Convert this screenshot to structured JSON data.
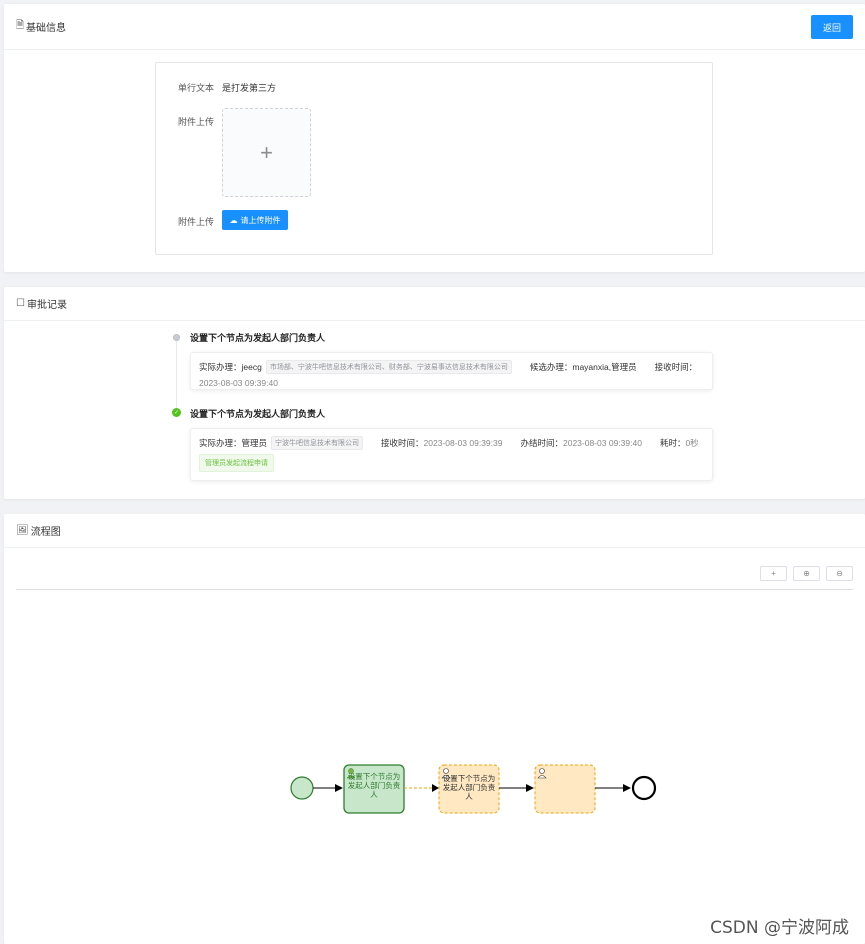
{
  "basic": {
    "title": "基础信息",
    "icon": "document-icon",
    "back_label": "返回",
    "fields": [
      {
        "label": "单行文本",
        "value": "是打发第三方"
      },
      {
        "label": "附件上传"
      },
      {
        "label": "附件上传"
      }
    ],
    "upload_plus": "+",
    "upload_button": "请上传附件"
  },
  "approval": {
    "title": "审批记录",
    "icon": "square-icon",
    "items": [
      {
        "title": "设置下个节点为发起人部门负责人",
        "actual_label": "实际办理：",
        "actual_value": "jeecg",
        "actual_tag": "市场部、宁波牛吧信息技术有限公司、财务部、宁波易事达信息技术有限公司",
        "candidate_label": "候选办理：",
        "candidate_value": "mayanxia,管理员",
        "receive_label": "接收时间：",
        "receive_value": "2023-08-03 09:39:40"
      },
      {
        "title": "设置下个节点为发起人部门负责人",
        "actual_label": "实际办理：",
        "actual_value": "管理员",
        "actual_tag": "宁波牛吧信息技术有限公司",
        "receive_label": "接收时间：",
        "receive_value": "2023-08-03 09:39:39",
        "done_label": "办结时间：",
        "done_value": "2023-08-03 09:39:40",
        "cost_label": "耗时：",
        "cost_value": "0秒",
        "comment": "管理员发起流程申请"
      }
    ]
  },
  "flow": {
    "title": "流程图",
    "icon": "image-icon",
    "tools": [
      "+",
      "⊕",
      "⊖"
    ],
    "nodes": [
      {
        "text": "设置下个节点为发起人部门负责人",
        "state": "done"
      },
      {
        "text": "设置下个节点为发起人部门负责人",
        "state": "current"
      },
      {
        "text": "",
        "state": "pending"
      }
    ],
    "colors": {
      "done_fill": "#c8e6c9",
      "done_stroke": "#2e7d32",
      "pending_fill": "#ffe8c2",
      "pending_stroke": "#f0a30a"
    }
  },
  "watermark": "CSDN @宁波阿成"
}
